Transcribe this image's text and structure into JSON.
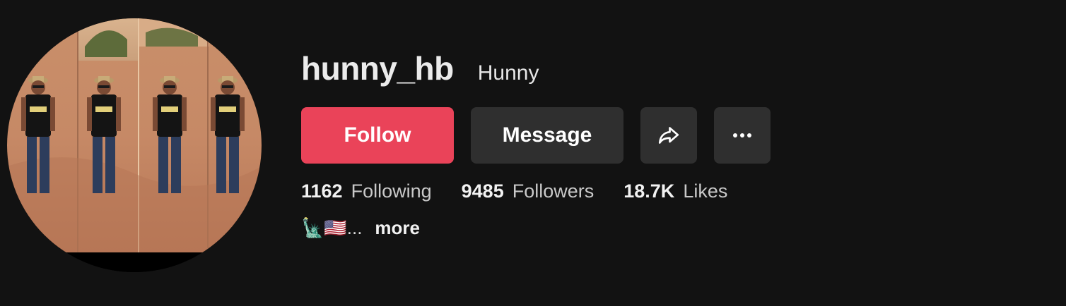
{
  "profile": {
    "username": "hunny_hb",
    "nickname": "Hunny",
    "avatar_alt": "avatar"
  },
  "actions": {
    "follow_label": "Follow",
    "message_label": "Message",
    "share_icon": "share-icon",
    "more_icon": "more-horizontal-icon"
  },
  "stats": {
    "following_count": "1162",
    "following_label": "Following",
    "followers_count": "9485",
    "followers_label": "Followers",
    "likes_count": "18.7K",
    "likes_label": "Likes"
  },
  "bio": {
    "text": "🗽🇺🇸...",
    "more_label": "more"
  },
  "colors": {
    "background": "#121212",
    "follow_button": "#ea4359",
    "secondary_button": "#2f2f2f"
  }
}
